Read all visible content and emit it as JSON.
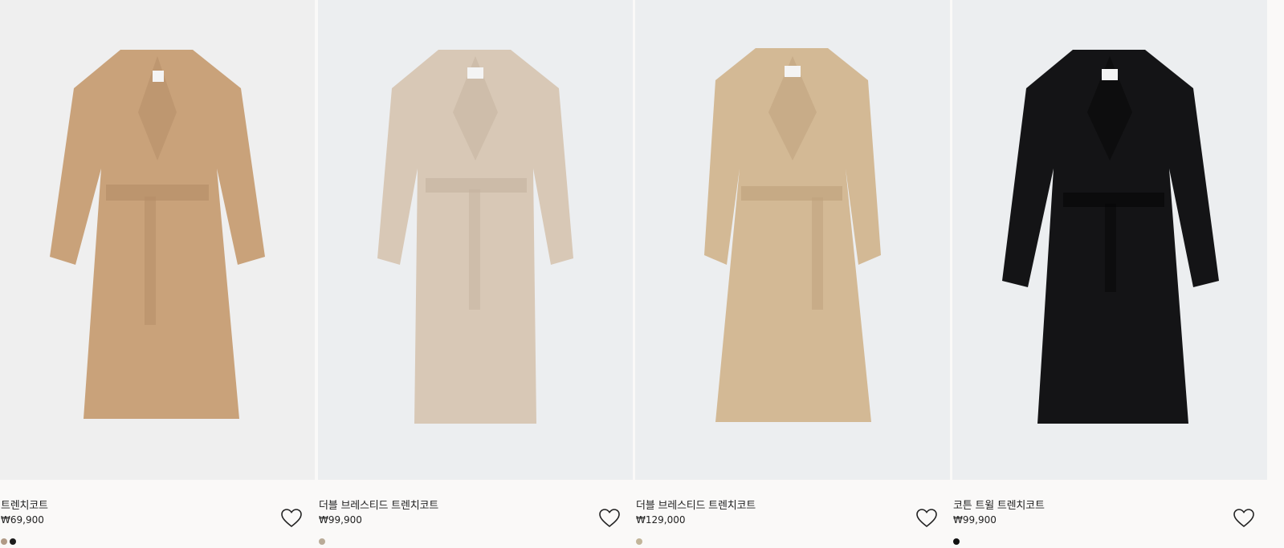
{
  "products": [
    {
      "title": "트렌치코트",
      "price": "₩69,900",
      "coat_color": "#c9a27a",
      "coat_shade": "#b48c65",
      "swatches": [
        "#b09a86",
        "#1c1c1c"
      ],
      "favorite_icon": "heart-outline-icon"
    },
    {
      "title": "더블 브레스티드 트렌치코트",
      "price": "₩99,900",
      "coat_color": "#d8c8b6",
      "coat_shade": "#c4b29e",
      "swatches": [
        "#b9ab98"
      ],
      "favorite_icon": "heart-outline-icon"
    },
    {
      "title": "더블 브레스티드 트렌치코트",
      "price": "₩129,000",
      "coat_color": "#d3b995",
      "coat_shade": "#bea07c",
      "swatches": [
        "#c2b59a"
      ],
      "favorite_icon": "heart-outline-icon"
    },
    {
      "title": "코튼 트윌 트렌치코트",
      "price": "₩99,900",
      "coat_color": "#141416",
      "coat_shade": "#050506",
      "swatches": [
        "#111111"
      ],
      "favorite_icon": "heart-outline-icon"
    }
  ]
}
